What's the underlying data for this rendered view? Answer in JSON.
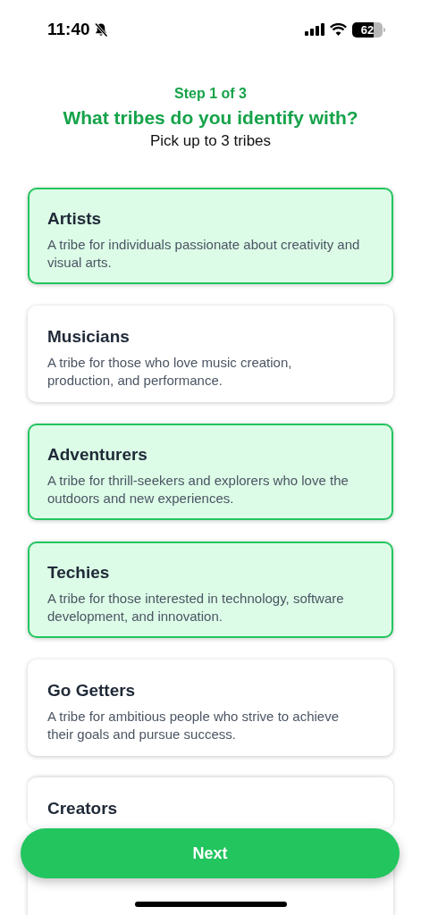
{
  "status_bar": {
    "time": "11:40",
    "silent": true,
    "battery": "62"
  },
  "header": {
    "step": "Step 1 of 3",
    "title": "What tribes do you identify with?",
    "subtitle": "Pick up to 3 tribes"
  },
  "tribes": [
    {
      "name": "Artists",
      "description": "A tribe for individuals passionate about creativity and visual arts.",
      "selected": true
    },
    {
      "name": "Musicians",
      "description": "A tribe for those who love music creation, production, and performance.",
      "selected": false
    },
    {
      "name": "Adventurers",
      "description": "A tribe for thrill-seekers and explorers who love the outdoors and new experiences.",
      "selected": true
    },
    {
      "name": "Techies",
      "description": "A tribe for those interested in technology, software development, and innovation.",
      "selected": true
    },
    {
      "name": "Go Getters",
      "description": "A tribe for ambitious people who strive to achieve their goals and pursue success.",
      "selected": false
    },
    {
      "name": "Creators",
      "selected": false
    }
  ],
  "next_button": "Next"
}
